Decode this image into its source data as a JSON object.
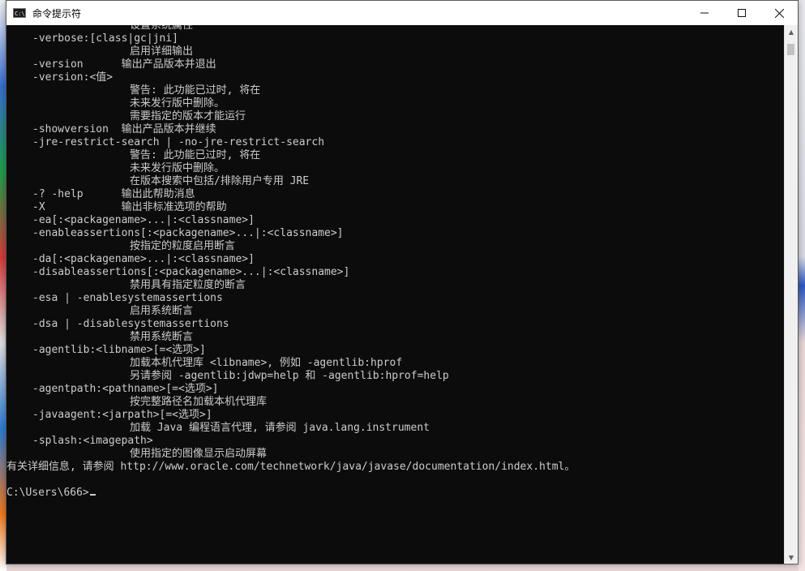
{
  "window": {
    "title": "命令提示符",
    "icon_text": "C:\\",
    "controls": {
      "minimize": "─",
      "maximize": "☐",
      "close": "✕"
    }
  },
  "console": {
    "lines": [
      {
        "indent": 19,
        "text": "设置系统属性"
      },
      {
        "indent": 4,
        "text": "-verbose:[class|gc|jni]"
      },
      {
        "indent": 19,
        "text": "启用详细输出"
      },
      {
        "indent": 4,
        "text": "-version      输出产品版本并退出"
      },
      {
        "indent": 4,
        "text": "-version:<值>"
      },
      {
        "indent": 19,
        "text": "警告: 此功能已过时, 将在"
      },
      {
        "indent": 19,
        "text": "未来发行版中删除。"
      },
      {
        "indent": 19,
        "text": "需要指定的版本才能运行"
      },
      {
        "indent": 4,
        "text": "-showversion  输出产品版本并继续"
      },
      {
        "indent": 4,
        "text": "-jre-restrict-search | -no-jre-restrict-search"
      },
      {
        "indent": 19,
        "text": "警告: 此功能已过时, 将在"
      },
      {
        "indent": 19,
        "text": "未来发行版中删除。"
      },
      {
        "indent": 19,
        "text": "在版本搜索中包括/排除用户专用 JRE"
      },
      {
        "indent": 4,
        "text": "-? -help      输出此帮助消息"
      },
      {
        "indent": 4,
        "text": "-X            输出非标准选项的帮助"
      },
      {
        "indent": 4,
        "text": "-ea[:<packagename>...|:<classname>]"
      },
      {
        "indent": 4,
        "text": "-enableassertions[:<packagename>...|:<classname>]"
      },
      {
        "indent": 19,
        "text": "按指定的粒度启用断言"
      },
      {
        "indent": 4,
        "text": "-da[:<packagename>...|:<classname>]"
      },
      {
        "indent": 4,
        "text": "-disableassertions[:<packagename>...|:<classname>]"
      },
      {
        "indent": 19,
        "text": "禁用具有指定粒度的断言"
      },
      {
        "indent": 4,
        "text": "-esa | -enablesystemassertions"
      },
      {
        "indent": 19,
        "text": "启用系统断言"
      },
      {
        "indent": 4,
        "text": "-dsa | -disablesystemassertions"
      },
      {
        "indent": 19,
        "text": "禁用系统断言"
      },
      {
        "indent": 4,
        "text": "-agentlib:<libname>[=<选项>]"
      },
      {
        "indent": 19,
        "text": "加载本机代理库 <libname>, 例如 -agentlib:hprof"
      },
      {
        "indent": 19,
        "text": "另请参阅 -agentlib:jdwp=help 和 -agentlib:hprof=help"
      },
      {
        "indent": 4,
        "text": "-agentpath:<pathname>[=<选项>]"
      },
      {
        "indent": 19,
        "text": "按完整路径名加载本机代理库"
      },
      {
        "indent": 4,
        "text": "-javaagent:<jarpath>[=<选项>]"
      },
      {
        "indent": 19,
        "text": "加载 Java 编程语言代理, 请参阅 java.lang.instrument"
      },
      {
        "indent": 4,
        "text": "-splash:<imagepath>"
      },
      {
        "indent": 19,
        "text": "使用指定的图像显示启动屏幕"
      },
      {
        "indent": 0,
        "text": "有关详细信息, 请参阅 http://www.oracle.com/technetwork/java/javase/documentation/index.html。"
      },
      {
        "indent": 0,
        "text": ""
      },
      {
        "indent": 0,
        "text": "C:\\Users\\666>"
      }
    ],
    "prompt": "C:\\Users\\666>"
  },
  "scrollbar": {
    "up": "▲",
    "down": "▼"
  }
}
